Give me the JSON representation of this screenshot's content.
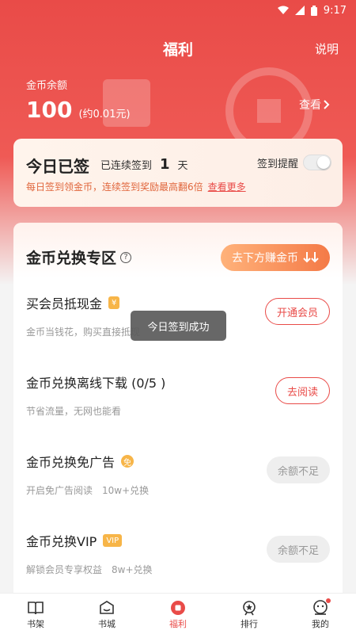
{
  "status": {
    "time": "9:17"
  },
  "nav": {
    "title": "福利",
    "help": "说明"
  },
  "balance": {
    "label": "金币余额",
    "value": "100",
    "approx": "(约0.01元)",
    "view_label": "查看"
  },
  "signin": {
    "title": "今日已签",
    "streak_prefix": "已连续签到",
    "streak_days": "1",
    "streak_unit": "天",
    "reminder_label": "签到提醒",
    "reminder_on": false,
    "desc": "每日签到领金币，连续签到奖励最高翻6倍",
    "more_link": "查看更多"
  },
  "exchange": {
    "title": "金币兑换专区",
    "help_symbol": "?",
    "earn_button": "去下方赚金币",
    "items": [
      {
        "title": "买会员抵现金",
        "tag": "¥",
        "subtitle": "金币当钱花，购买直接抵现",
        "extra": "",
        "action": "开通会员",
        "action_state": "active"
      },
      {
        "title": "金币兑换离线下载 (0/5 )",
        "tag": "",
        "subtitle": "节省流量，无网也能看",
        "extra": "",
        "action": "去阅读",
        "action_state": "active"
      },
      {
        "title": "金币兑换免广告",
        "tag": "免",
        "subtitle": "开启免广告阅读",
        "extra": "10w+兑换",
        "action": "余额不足",
        "action_state": "disabled"
      },
      {
        "title": "金币兑换VIP",
        "tag": "VIP",
        "subtitle": "解锁会员专享权益",
        "extra": "8w+兑换",
        "action": "余额不足",
        "action_state": "disabled"
      }
    ]
  },
  "toast": "今日签到成功",
  "tabs": [
    {
      "label": "书架",
      "icon": "book-icon",
      "active": false
    },
    {
      "label": "书城",
      "icon": "store-icon",
      "active": false
    },
    {
      "label": "福利",
      "icon": "gift-icon",
      "active": true
    },
    {
      "label": "排行",
      "icon": "rank-icon",
      "active": false
    },
    {
      "label": "我的",
      "icon": "profile-icon",
      "active": false
    }
  ],
  "colors": {
    "accent": "#e94b48",
    "orange": "#f47a47",
    "tag": "#f7b548"
  }
}
